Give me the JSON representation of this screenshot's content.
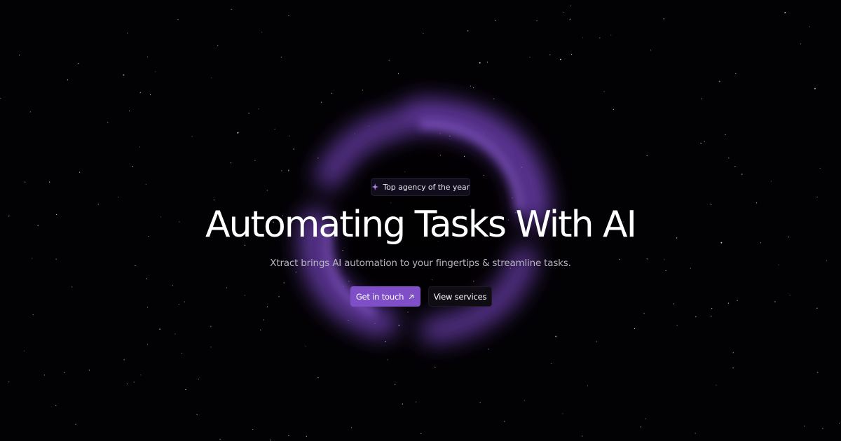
{
  "hero": {
    "badge": {
      "icon": "sparkle-icon",
      "text": "Top agency of the year"
    },
    "headline": "Automating Tasks With AI",
    "subline": "Xtract brings AI automation to your fingertips & streamline tasks.",
    "primary_button": {
      "label": "Get in touch",
      "icon": "arrow-up-right-icon"
    },
    "secondary_button": {
      "label": "View services"
    }
  },
  "colors": {
    "background": "#020103",
    "accent": "#7e4fc6",
    "glow": "#7a4bc0",
    "text_primary": "#ffffff",
    "text_secondary": "#b9b4c1"
  }
}
